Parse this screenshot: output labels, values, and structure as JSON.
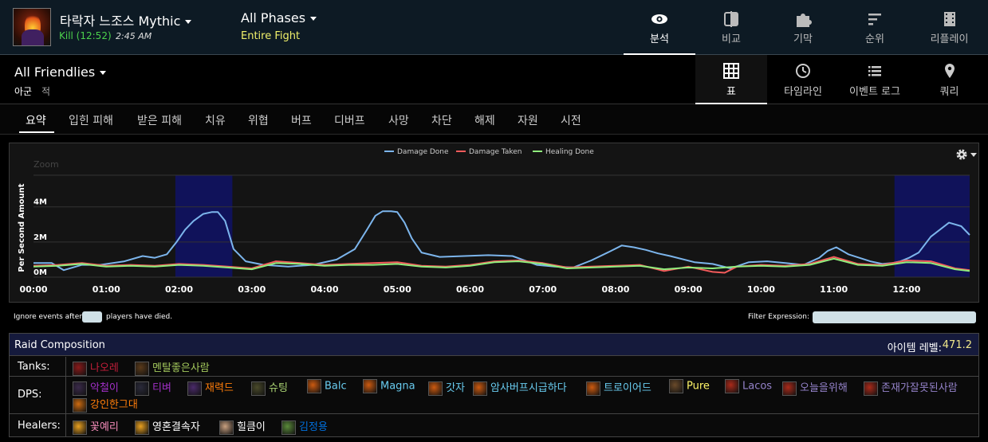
{
  "header": {
    "boss_title": "타락자 느조스 Mythic",
    "kill_status": "Kill (12:52)",
    "kill_time": "2:45 AM",
    "phase_title": "All Phases",
    "phase_sub": "Entire Fight",
    "nav_tabs": [
      {
        "label": "분석",
        "icon": "eye-icon",
        "active": true
      },
      {
        "label": "비교",
        "icon": "compare-icon",
        "active": false
      },
      {
        "label": "기막",
        "icon": "puzzle-icon",
        "active": false
      },
      {
        "label": "순위",
        "icon": "ranking-icon",
        "active": false
      },
      {
        "label": "리플레이",
        "icon": "film-icon",
        "active": false
      }
    ]
  },
  "subbar": {
    "friendlies": "All Friendlies",
    "side_ally": "아군",
    "side_enemy": "적",
    "view_tabs": [
      {
        "label": "표",
        "icon": "grid-icon",
        "active": true
      },
      {
        "label": "타임라인",
        "icon": "clock-icon",
        "active": false
      },
      {
        "label": "이벤트 로그",
        "icon": "list-icon",
        "active": false
      },
      {
        "label": "쿼리",
        "icon": "pin-icon",
        "active": false
      }
    ]
  },
  "category_tabs": [
    "요약",
    "입힌 피해",
    "받은 피해",
    "치유",
    "위협",
    "버프",
    "디버프",
    "사망",
    "차단",
    "해제",
    "자원",
    "시전"
  ],
  "chart_data": {
    "type": "line",
    "zoom_label": "Zoom",
    "ylabel": "Per Second Amount",
    "xlabel": "",
    "x_ticks": [
      "00:00",
      "01:00",
      "02:00",
      "03:00",
      "04:00",
      "05:00",
      "06:00",
      "07:00",
      "08:00",
      "09:00",
      "10:00",
      "11:00",
      "12:00"
    ],
    "y_ticks": [
      "0M",
      "2M",
      "4M"
    ],
    "ylim": [
      0,
      5800000
    ],
    "xlim": [
      0,
      772
    ],
    "legend_position": "top-center",
    "grid": true,
    "highlight_bands": [
      [
        117,
        164
      ],
      [
        710,
        772
      ]
    ],
    "series": [
      {
        "name": "Damage Done",
        "color": "#7cb5ec",
        "x": [
          0,
          15,
          25,
          40,
          55,
          75,
          90,
          100,
          110,
          118,
          125,
          132,
          140,
          147,
          152,
          158,
          165,
          175,
          190,
          210,
          230,
          250,
          265,
          275,
          282,
          288,
          295,
          300,
          306,
          312,
          320,
          335,
          355,
          375,
          395,
          415,
          430,
          445,
          460,
          475,
          485,
          495,
          505,
          515,
          525,
          545,
          560,
          575,
          590,
          605,
          620,
          635,
          648,
          655,
          662,
          672,
          690,
          700,
          708,
          715,
          722,
          730,
          740,
          755,
          765,
          772
        ],
        "y": [
          800000,
          800000,
          400000,
          700000,
          700000,
          900000,
          1200000,
          1100000,
          1300000,
          2000000,
          2700000,
          3200000,
          3600000,
          3700000,
          3700000,
          3200000,
          1600000,
          900000,
          700000,
          600000,
          700000,
          1000000,
          1600000,
          2700000,
          3500000,
          3750000,
          3750000,
          3700000,
          3100000,
          2200000,
          1400000,
          1150000,
          1200000,
          1250000,
          1200000,
          700000,
          600000,
          550000,
          950000,
          1450000,
          1800000,
          1700000,
          1550000,
          1350000,
          1200000,
          850000,
          750000,
          500000,
          850000,
          900000,
          800000,
          700000,
          1100000,
          1500000,
          1700000,
          1300000,
          900000,
          750000,
          800000,
          900000,
          1100000,
          1400000,
          2300000,
          3100000,
          2900000,
          2400000
        ]
      },
      {
        "name": "Damage Taken",
        "color": "#f45b5b",
        "x": [
          0,
          20,
          40,
          60,
          80,
          100,
          120,
          140,
          160,
          180,
          200,
          220,
          240,
          260,
          280,
          300,
          320,
          340,
          360,
          380,
          400,
          420,
          440,
          460,
          480,
          500,
          520,
          540,
          560,
          570,
          580,
          600,
          620,
          640,
          660,
          680,
          700,
          720,
          740,
          760,
          772
        ],
        "y": [
          650000,
          700000,
          800000,
          650000,
          700000,
          650000,
          750000,
          700000,
          600000,
          500000,
          900000,
          800000,
          700000,
          750000,
          800000,
          850000,
          650000,
          600000,
          700000,
          900000,
          950000,
          800000,
          550000,
          600000,
          650000,
          700000,
          350000,
          600000,
          300000,
          250000,
          600000,
          700000,
          650000,
          750000,
          1150000,
          750000,
          700000,
          950000,
          900000,
          500000,
          400000
        ]
      },
      {
        "name": "Healing Done",
        "color": "#90ed7d",
        "x": [
          0,
          20,
          40,
          60,
          80,
          100,
          120,
          140,
          160,
          180,
          200,
          220,
          240,
          260,
          280,
          300,
          320,
          340,
          360,
          380,
          400,
          420,
          440,
          460,
          480,
          500,
          520,
          540,
          560,
          580,
          600,
          620,
          640,
          660,
          680,
          700,
          720,
          740,
          760,
          772
        ],
        "y": [
          600000,
          650000,
          750000,
          600000,
          650000,
          600000,
          700000,
          650000,
          550000,
          450000,
          800000,
          750000,
          650000,
          700000,
          700000,
          750000,
          600000,
          550000,
          650000,
          850000,
          900000,
          750000,
          500000,
          550000,
          600000,
          650000,
          450000,
          550000,
          500000,
          600000,
          650000,
          600000,
          700000,
          1050000,
          700000,
          650000,
          850000,
          800000,
          450000,
          350000
        ]
      }
    ]
  },
  "filters": {
    "ignore_before": "Ignore events after",
    "ignore_after": "players have died.",
    "filter_label": "Filter Expression:"
  },
  "raid": {
    "title": "Raid Composition",
    "ilvl_label": "아이템 레벨:",
    "ilvl_value": "471.2",
    "tanks_label": "Tanks:",
    "dps_label": "DPS:",
    "healers_label": "Healers:",
    "tanks": [
      {
        "name": "나오레",
        "color": "#c41e3a",
        "icon": "demon-hunter-icon",
        "icon_color": "#8a1a1a"
      },
      {
        "name": "멘탈좋은사람",
        "color": "#a3c85c",
        "icon": "druid-bear-icon",
        "icon_color": "#5a3a1a"
      }
    ],
    "dps": [
      {
        "name": "악철이",
        "color": "#a330c9",
        "icon": "dh-havoc-icon",
        "icon_color": "#3a2a4a"
      },
      {
        "name": "티벼",
        "color": "#a330c9",
        "icon": "dh-havoc-icon",
        "icon_color": "#2a2a3a"
      },
      {
        "name": "재력드",
        "color": "#ff7d0a",
        "icon": "balance-icon",
        "icon_color": "#4a2a6a"
      },
      {
        "name": "슈팅",
        "color": "#abd473",
        "icon": "hunter-icon",
        "icon_color": "#4a4a2a"
      },
      {
        "name": "Balc",
        "color": "#69ccf0",
        "icon": "fire-mage-icon",
        "icon_color": "#cc5a10"
      },
      {
        "name": "Magna",
        "color": "#69ccf0",
        "icon": "fire-mage-icon",
        "icon_color": "#cc5a10"
      },
      {
        "name": "갓자",
        "color": "#69ccf0",
        "icon": "fire-mage-icon",
        "icon_color": "#cc5a10"
      },
      {
        "name": "암사버프시급하다",
        "color": "#69ccf0",
        "icon": "fire-mage-icon",
        "icon_color": "#cc5a10"
      },
      {
        "name": "트로이어드",
        "color": "#69ccf0",
        "icon": "fire-mage-icon",
        "icon_color": "#cc5a10"
      },
      {
        "name": "Pure",
        "color": "#fff569",
        "icon": "rogue-icon",
        "icon_color": "#6a4a2a"
      },
      {
        "name": "Lacos",
        "color": "#9482c9",
        "icon": "warlock-icon",
        "icon_color": "#aa2a1a"
      },
      {
        "name": "오늘을위해",
        "color": "#9482c9",
        "icon": "warlock-icon",
        "icon_color": "#aa2a1a"
      },
      {
        "name": "존재가잘못된사람",
        "color": "#9482c9",
        "icon": "warlock-icon",
        "icon_color": "#aa2a1a"
      },
      {
        "name": "강인한그대",
        "color": "#ff7d0a",
        "icon": "druid-feral-icon",
        "icon_color": "#cc6a10"
      }
    ],
    "healers": [
      {
        "name": "꽃예리",
        "color": "#f58cba",
        "icon": "holy-paladin-icon",
        "icon_color": "#e8a020"
      },
      {
        "name": "영혼결속자",
        "color": "#ffffff",
        "icon": "holy-priest-icon",
        "icon_color": "#e8a020"
      },
      {
        "name": "힐큼이",
        "color": "#ffffff",
        "icon": "disc-priest-icon",
        "icon_color": "#c8a080"
      },
      {
        "name": "김정용",
        "color": "#0070de",
        "icon": "shaman-icon",
        "icon_color": "#5a8a3a"
      }
    ]
  }
}
